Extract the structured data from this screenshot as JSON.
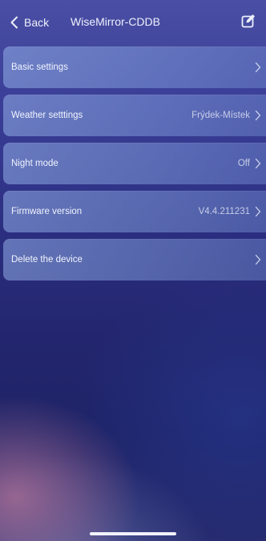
{
  "header": {
    "back_label": "Back",
    "title": "WiseMirror-CDDB",
    "edit_icon": "edit-icon"
  },
  "settings": {
    "items": [
      {
        "label": "Basic settings",
        "value": ""
      },
      {
        "label": "Weather setttings",
        "value": "Frýdek-Místek"
      },
      {
        "label": "Night mode",
        "value": "Off"
      },
      {
        "label": "Firmware version",
        "value": "V4.4.211231"
      },
      {
        "label": "Delete the device",
        "value": ""
      }
    ]
  },
  "colors": {
    "background_top": "#4a4fa4",
    "background_bottom": "#1e2366",
    "row_fill": "#96b4eb",
    "text": "#f1f4fd"
  }
}
